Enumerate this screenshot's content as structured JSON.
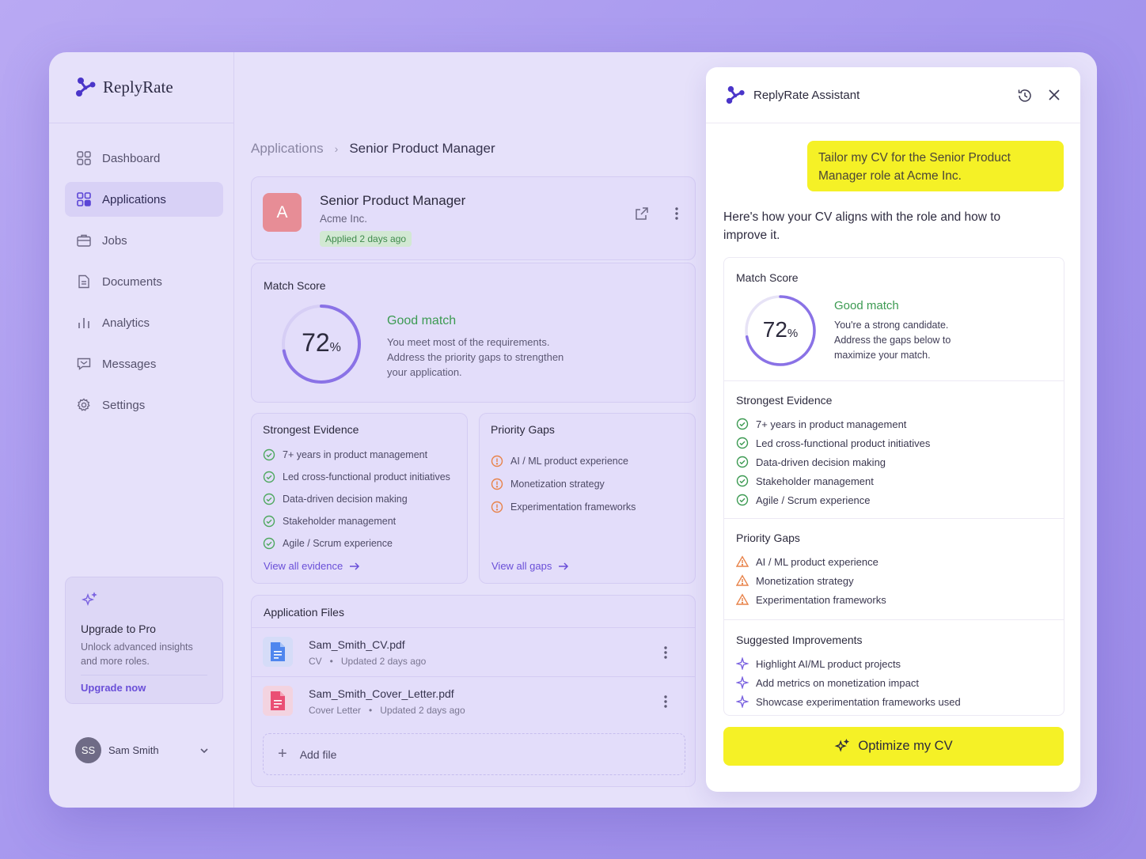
{
  "app": {
    "name": "ReplyRate"
  },
  "sidebar": {
    "items": [
      {
        "label": "Dashboard",
        "icon": "dashboard-icon"
      },
      {
        "label": "Applications",
        "icon": "applications-icon"
      },
      {
        "label": "Jobs",
        "icon": "briefcase-icon"
      },
      {
        "label": "Documents",
        "icon": "document-icon"
      },
      {
        "label": "Analytics",
        "icon": "bar-chart-icon"
      },
      {
        "label": "Messages",
        "icon": "message-icon"
      },
      {
        "label": "Settings",
        "icon": "gear-icon"
      }
    ],
    "active": "Applications",
    "upgrade": {
      "title": "Upgrade to Pro",
      "desc": "Unlock advanced insights and more roles.",
      "link": "Upgrade now"
    },
    "user": {
      "initials": "SS",
      "name": "Sam Smith"
    }
  },
  "breadcrumb": {
    "parent": "Applications",
    "current": "Senior Product Manager"
  },
  "job": {
    "initial": "A",
    "title": "Senior Product Manager",
    "company": "Acme Inc.",
    "status": "Applied 2 days ago"
  },
  "match": {
    "label": "Match Score",
    "score": 72,
    "score_text": "72",
    "unit": "%",
    "verdict": "Good match",
    "desc": "You meet most of the requirements. Address the priority gaps to strengthen your application."
  },
  "evidence": {
    "title": "Strongest Evidence",
    "items": [
      "7+ years in product management",
      "Led cross-functional product initiatives",
      "Data-driven decision making",
      "Stakeholder management",
      "Agile / Scrum experience"
    ],
    "link": "View all evidence"
  },
  "gaps": {
    "title": "Priority Gaps",
    "items": [
      "AI / ML product experience",
      "Monetization strategy",
      "Experimentation frameworks"
    ],
    "link": "View all gaps"
  },
  "files": {
    "title": "Application Files",
    "items": [
      {
        "name": "Sam_Smith_CV.pdf",
        "type": "CV",
        "updated": "Updated 2 days ago",
        "color": "#4f86ee"
      },
      {
        "name": "Sam_Smith_Cover_Letter.pdf",
        "type": "Cover Letter",
        "updated": "Updated 2 days ago",
        "color": "#ea4f74"
      }
    ],
    "add": "Add file"
  },
  "assistant": {
    "title": "ReplyRate Assistant",
    "user_message": "Tailor my CV for the Senior Product Manager role at Acme Inc.",
    "reply": "Here's how your CV aligns with the role and how to improve it.",
    "match": {
      "label": "Match Score",
      "score": 72,
      "score_text": "72",
      "unit": "%",
      "verdict": "Good match",
      "desc": "You're a strong candidate. Address the gaps below to maximize your match."
    },
    "evidence": {
      "title": "Strongest Evidence",
      "items": [
        "7+ years in product management",
        "Led cross-functional product initiatives",
        "Data-driven decision making",
        "Stakeholder management",
        "Agile / Scrum experience"
      ]
    },
    "gaps": {
      "title": "Priority Gaps",
      "items": [
        "AI / ML product experience",
        "Monetization strategy",
        "Experimentation frameworks"
      ]
    },
    "improvements": {
      "title": "Suggested Improvements",
      "items": [
        "Highlight AI/ML product projects",
        "Add metrics on monetization impact",
        "Showcase experimentation frameworks used"
      ]
    },
    "cta": "Optimize my CV"
  },
  "colors": {
    "accent": "#6a4fd8",
    "highlight": "#f5f126",
    "success": "#3c9a52",
    "warning": "#e8834a",
    "ring": "#8a72e6"
  }
}
